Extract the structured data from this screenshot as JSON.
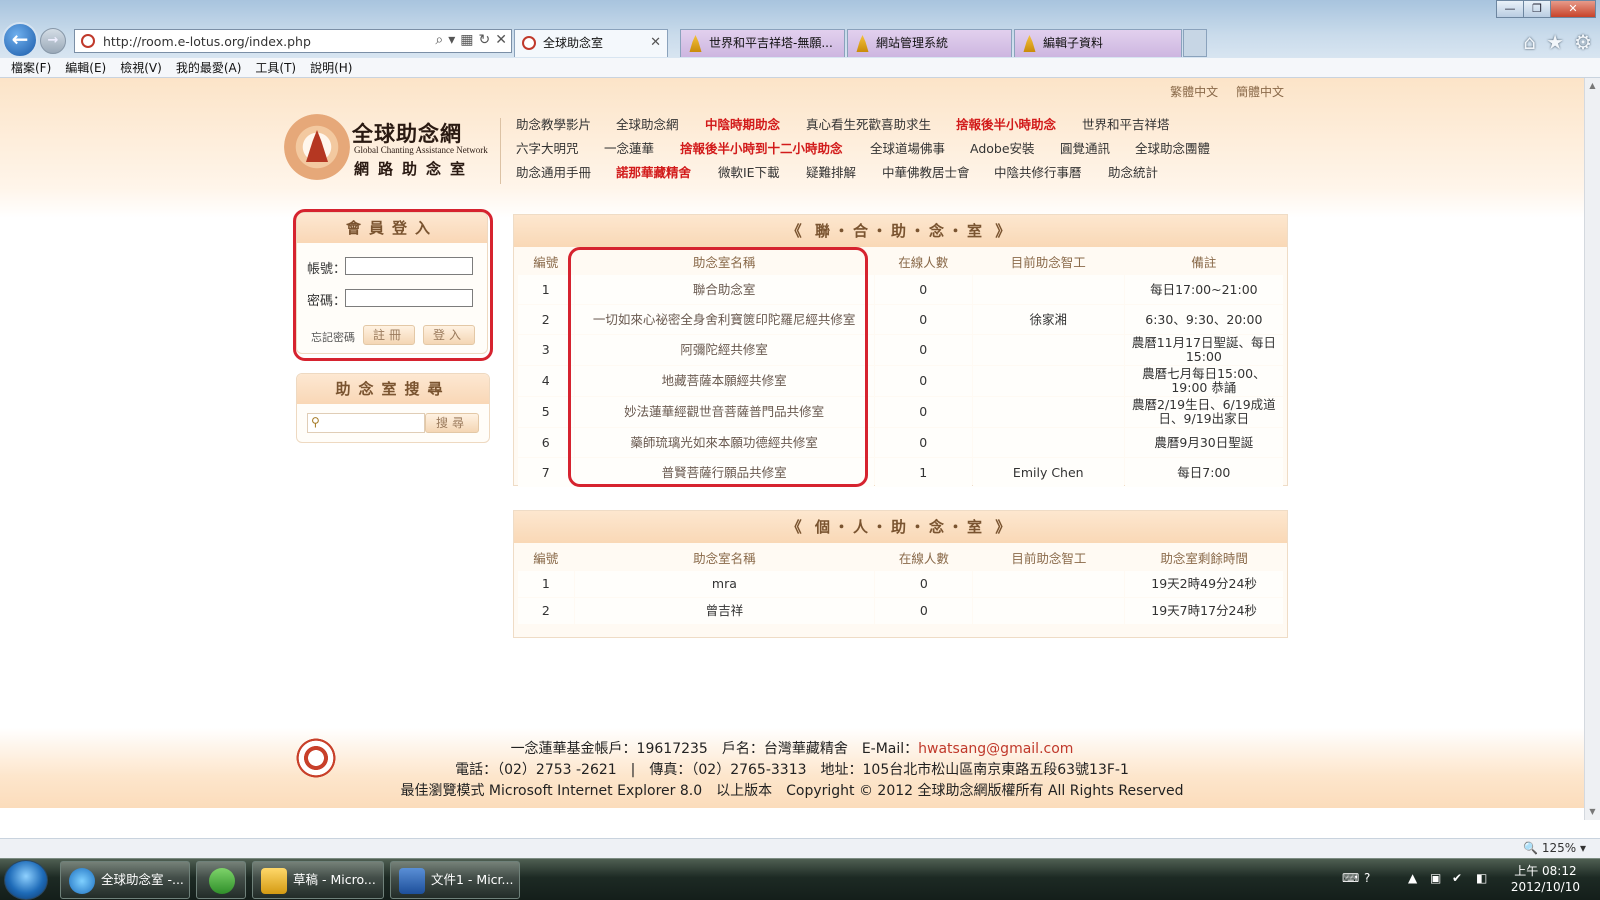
{
  "browser": {
    "window_controls": {
      "minimize": "—",
      "maximize": "❐",
      "close": "✕"
    },
    "back_icon": "←",
    "forward_icon": "→",
    "url": "http://room.e-lotus.org/index.php",
    "address_tools": {
      "search": "⌕",
      "dropdown": "▾",
      "compat": "▦",
      "refresh": "↻",
      "stop": "✕"
    },
    "tabs": [
      {
        "label": "全球助念室",
        "close": "✕"
      },
      {
        "label": "世界和平吉祥塔-無願..."
      },
      {
        "label": "網站管理系統"
      },
      {
        "label": "編輯子資料"
      }
    ],
    "toolbar_icons": {
      "home": "⌂",
      "favorites": "★",
      "tools": "⚙"
    },
    "menu": [
      "檔案(F)",
      "編輯(E)",
      "檢視(V)",
      "我的最愛(A)",
      "工具(T)",
      "說明(H)"
    ]
  },
  "page": {
    "lang_links": [
      "繁體中文",
      "簡體中文"
    ],
    "logo": {
      "name_zh": "全球助念網",
      "name_en": "Global Chanting Assistance Network",
      "name_sub": "網路助念室"
    },
    "nav": [
      [
        {
          "label": "助念教學影片",
          "hot": false
        },
        {
          "label": "全球助念網",
          "hot": false
        },
        {
          "label": "中陰時期助念",
          "hot": true
        },
        {
          "label": "真心看生死歡喜助求生",
          "hot": false
        },
        {
          "label": "捨報後半小時助念",
          "hot": true
        },
        {
          "label": "世界和平吉祥塔",
          "hot": false
        }
      ],
      [
        {
          "label": "六字大明咒",
          "hot": false
        },
        {
          "label": "一念蓮華",
          "hot": false
        },
        {
          "label": "捨報後半小時到十二小時助念",
          "hot": true
        },
        {
          "label": "全球道場佛事",
          "hot": false
        },
        {
          "label": "Adobe安裝",
          "hot": false
        },
        {
          "label": "圓覺通訊",
          "hot": false
        },
        {
          "label": "全球助念團體",
          "hot": false
        }
      ],
      [
        {
          "label": "助念通用手冊",
          "hot": false
        },
        {
          "label": "諾那華藏精舍",
          "hot": true
        },
        {
          "label": "微軟IE下載",
          "hot": false
        },
        {
          "label": "疑難排解",
          "hot": false
        },
        {
          "label": "中華佛教居士會",
          "hot": false
        },
        {
          "label": "中陰共修行事曆",
          "hot": false
        },
        {
          "label": "助念統計",
          "hot": false
        }
      ]
    ],
    "login": {
      "title": "會員登入",
      "account_label": "帳號：",
      "account_value": "",
      "password_label": "密碼：",
      "password_value": "",
      "forgot": "忘記密碼",
      "register": "註冊",
      "submit": "登入"
    },
    "search": {
      "title": "助念室搜尋",
      "icon": "⚲",
      "value": "",
      "button": "搜尋"
    },
    "joint_rooms": {
      "title": "《 聯‧合‧助‧念‧室 》",
      "headers": [
        "編號",
        "助念室名稱",
        "在線人數",
        "目前助念智工",
        "備註"
      ],
      "rows": [
        [
          "1",
          "聯合助念室",
          "0",
          "",
          "每日17:00~21:00"
        ],
        [
          "2",
          "一切如來心祕密全身舍利寶篋印陀羅尼經共修室",
          "0",
          "徐家湘",
          "6:30、9:30、20:00"
        ],
        [
          "3",
          "阿彌陀經共修室",
          "0",
          "",
          "農曆11月17日聖誕、每日15:00"
        ],
        [
          "4",
          "地藏菩薩本願經共修室",
          "0",
          "",
          "農曆七月每日15:00、19:00 恭誦"
        ],
        [
          "5",
          "妙法蓮華經觀世音菩薩普門品共修室",
          "0",
          "",
          "農曆2/19生日、6/19成道日、9/19出家日"
        ],
        [
          "6",
          "藥師琉璃光如來本願功德經共修室",
          "0",
          "",
          "農曆9月30日聖誕"
        ],
        [
          "7",
          "普賢菩薩行願品共修室",
          "1",
          "Emily Chen",
          "每日7:00"
        ]
      ]
    },
    "personal_rooms": {
      "title": "《 個‧人‧助‧念‧室 》",
      "headers": [
        "編號",
        "助念室名稱",
        "在線人數",
        "目前助念智工",
        "助念室剩餘時間"
      ],
      "rows": [
        [
          "1",
          "mra",
          "0",
          "",
          "19天2時49分24秒"
        ],
        [
          "2",
          "曾吉祥",
          "0",
          "",
          "19天7時17分24秒"
        ]
      ]
    },
    "footer": {
      "line1_prefix": "一念蓮華基金帳戶：19617235　戶名：台灣華藏精舍　E-Mail：",
      "email": "hwatsang@gmail.com",
      "line2": "電話：（02）2753 -2621　|　傳真：（02）2765-3313　地址：105台北市松山區南京東路五段63號13F-1",
      "line3": "最佳瀏覽模式  Microsoft Internet Explorer 8.0　以上版本　Copyright © 2012 全球助念網版權所有 All Rights Reserved"
    }
  },
  "statusbar": {
    "zoom": "🔍 125%  ▾"
  },
  "taskbar": {
    "items": [
      "全球助念室 -...",
      "",
      "草稿 - Micro...",
      "文件1 - Micr..."
    ],
    "clock_time": "上午 08:12",
    "clock_date": "2012/10/10"
  },
  "colors": {
    "accent_red": "#d21b1b",
    "highlight_red": "#d6232f",
    "header_peach": "#fce4c8",
    "title_brown": "#7a5430"
  }
}
